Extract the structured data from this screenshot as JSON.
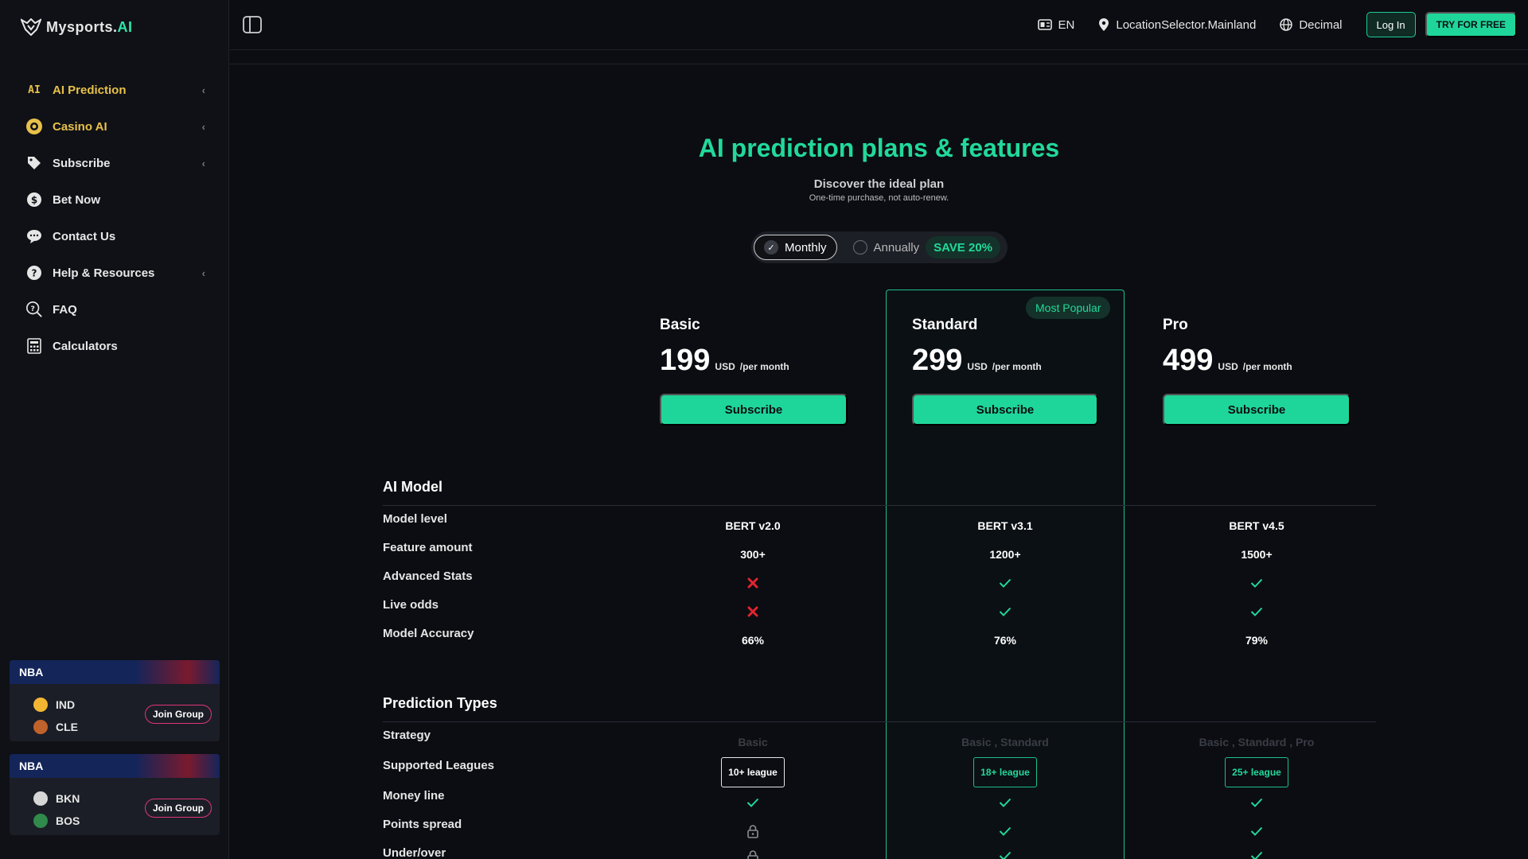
{
  "app": {
    "logo_text": "Mysports.",
    "logo_accent": "AI"
  },
  "sidebar": {
    "items": [
      {
        "label": "AI Prediction",
        "icon": "ai-icon",
        "active": true,
        "chevron": true
      },
      {
        "label": "Casino AI",
        "icon": "casino-chip-icon",
        "active": true,
        "chevron": true
      },
      {
        "label": "Subscribe",
        "icon": "tag-icon",
        "active": false,
        "chevron": true
      },
      {
        "label": "Bet Now",
        "icon": "dollar-icon",
        "active": false,
        "chevron": false
      },
      {
        "label": "Contact Us",
        "icon": "chat-icon",
        "active": false,
        "chevron": false
      },
      {
        "label": "Help & Resources",
        "icon": "help-icon",
        "active": false,
        "chevron": true
      },
      {
        "label": "FAQ",
        "icon": "faq-icon",
        "active": false,
        "chevron": false
      },
      {
        "label": "Calculators",
        "icon": "calculator-icon",
        "active": false,
        "chevron": false
      }
    ],
    "ai_icon_text": "AI",
    "matches": [
      {
        "league": "NBA",
        "team1": "IND",
        "team2": "CLE",
        "join_label": "Join Group"
      },
      {
        "league": "NBA",
        "team1": "BKN",
        "team2": "BOS",
        "join_label": "Join Group"
      }
    ]
  },
  "topbar": {
    "language": "EN",
    "location": "LocationSelector.Mainland",
    "odds_format": "Decimal",
    "login_label": "Log In",
    "try_label": "TRY FOR FREE"
  },
  "hero": {
    "title": "AI prediction plans & features",
    "subtitle": "Discover the ideal plan",
    "note": "One-time purchase, not auto-renew."
  },
  "billing": {
    "monthly_label": "Monthly",
    "annually_label": "Annually",
    "save_label": "SAVE 20%",
    "selected": "monthly"
  },
  "plans": [
    {
      "name": "Basic",
      "price": "199",
      "currency": "USD",
      "period": "/per month",
      "cta": "Subscribe"
    },
    {
      "name": "Standard",
      "price": "299",
      "currency": "USD",
      "period": "/per month",
      "cta": "Subscribe",
      "badge": "Most Popular"
    },
    {
      "name": "Pro",
      "price": "499",
      "currency": "USD",
      "period": "/per month",
      "cta": "Subscribe"
    }
  ],
  "ai_model": {
    "title": "AI Model",
    "rows": [
      {
        "label": "Model level",
        "values": [
          "BERT v2.0",
          "BERT v3.1",
          "BERT v4.5"
        ]
      },
      {
        "label": "Feature amount",
        "values": [
          "300+",
          "1200+",
          "1500+"
        ]
      },
      {
        "label": "Advanced Stats",
        "values": [
          "cross",
          "check",
          "check"
        ]
      },
      {
        "label": "Live odds",
        "values": [
          "cross",
          "check",
          "check"
        ]
      },
      {
        "label": "Model Accuracy",
        "values": [
          "66%",
          "76%",
          "79%"
        ]
      }
    ]
  },
  "prediction_types": {
    "title": "Prediction Types",
    "strategy_label": "Strategy",
    "strategy_values": [
      "Basic",
      "Basic , Standard",
      "Basic , Standard , Pro"
    ],
    "leagues_label": "Supported Leagues",
    "league_values": [
      "10+ league",
      "18+ league",
      "25+ league"
    ],
    "rows": [
      {
        "label": "Money line",
        "values": [
          "check",
          "check",
          "check"
        ]
      },
      {
        "label": "Points spread",
        "values": [
          "lock",
          "check",
          "check"
        ]
      },
      {
        "label": "Under/over",
        "values": [
          "lock",
          "check",
          "check"
        ]
      }
    ]
  },
  "colors": {
    "accent": "#22d99a",
    "button": "#1fd69a",
    "gold": "#e8c14a",
    "cross": "#e0242f",
    "check": "#22d99a"
  }
}
